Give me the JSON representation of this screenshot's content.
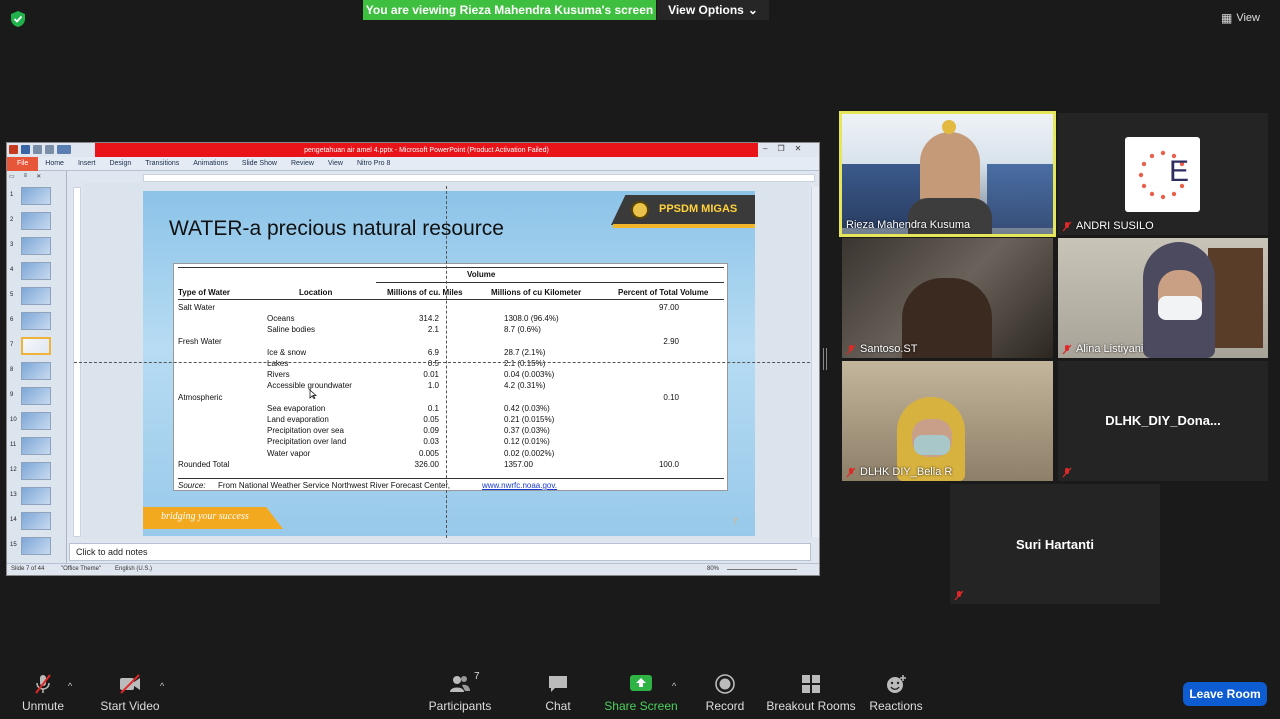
{
  "banner": {
    "text": "You are viewing Rieza Mahendra Kusuma's screen",
    "view_options": "View Options"
  },
  "top_right": {
    "view_label": "View"
  },
  "ppt": {
    "title": "pengetahuan air amel 4.pptx - Microsoft PowerPoint (Product Activation Failed)",
    "tabs": [
      "File",
      "Home",
      "Insert",
      "Design",
      "Transitions",
      "Animations",
      "Slide Show",
      "Review",
      "View",
      "Nitro Pro 8"
    ],
    "thumb_numbers": [
      "1",
      "2",
      "3",
      "4",
      "5",
      "6",
      "7",
      "8",
      "9",
      "10",
      "11",
      "12",
      "13",
      "14",
      "15"
    ],
    "notes_placeholder": "Click to add notes",
    "status": {
      "slide": "Slide 7 of 44",
      "theme": "\"Office Theme\"",
      "language": "English (U.S.)",
      "zoom": "80%"
    },
    "slide": {
      "title": "WATER-a precious natural resource",
      "logo": "PPSDM MIGAS",
      "footer": "bridging your success",
      "page_number": "7",
      "table": {
        "group_header": "Volume",
        "headers": [
          "Type of Water",
          "Location",
          "Millions of cu. Miles",
          "Millions of cu Kilometer",
          "Percent of Total Volume"
        ],
        "rows": [
          {
            "type": "Salt Water",
            "loc": "",
            "miles": "",
            "km": "",
            "pct": "97.00"
          },
          {
            "type": "",
            "loc": "Oceans",
            "miles": "314.2",
            "km": "1308.0  (96.4%)",
            "pct": ""
          },
          {
            "type": "",
            "loc": "Saline bodies",
            "miles": "2.1",
            "km": "8.7  (0.6%)",
            "pct": ""
          },
          {
            "type": "Fresh Water",
            "loc": "",
            "miles": "",
            "km": "",
            "pct": "2.90"
          },
          {
            "type": "",
            "loc": "Ice & snow",
            "miles": "6.9",
            "km": "28.7  (2.1%)",
            "pct": ""
          },
          {
            "type": "",
            "loc": "Lakes",
            "miles": "0.5",
            "km": "2.1  (0.15%)",
            "pct": ""
          },
          {
            "type": "",
            "loc": "Rivers",
            "miles": "0.01",
            "km": "0.04 (0.003%)",
            "pct": ""
          },
          {
            "type": "",
            "loc": "Accessible groundwater",
            "miles": "1.0",
            "km": "4.2  (0.31%)",
            "pct": ""
          },
          {
            "type": "Atmospheric",
            "loc": "",
            "miles": "",
            "km": "",
            "pct": "0.10"
          },
          {
            "type": "",
            "loc": "Sea evaporation",
            "miles": "0.1",
            "km": "0.42 (0.03%)",
            "pct": ""
          },
          {
            "type": "",
            "loc": "Land evaporation",
            "miles": "0.05",
            "km": "0.21 (0.015%)",
            "pct": ""
          },
          {
            "type": "",
            "loc": "Precipitation over sea",
            "miles": "0.09",
            "km": "0.37 (0.03%)",
            "pct": ""
          },
          {
            "type": "",
            "loc": "Precipitation over land",
            "miles": "0.03",
            "km": "0.12 (0.01%)",
            "pct": ""
          },
          {
            "type": "",
            "loc": "Water vapor",
            "miles": "0.005",
            "km": "0.02 (0.002%)",
            "pct": ""
          },
          {
            "type": "Rounded Total",
            "loc": "",
            "miles": "326.00",
            "km": "1357.00",
            "pct": "100.0"
          }
        ],
        "source_label": "Source:",
        "source_text": "From National Weather Service Northwest River Forecast Center,",
        "source_link": "www.nwrfc.noaa.gov."
      }
    }
  },
  "participants": [
    {
      "name": "Rieza Mahendra Kusuma",
      "muted": false
    },
    {
      "name": "ANDRI SUSILO",
      "muted": true,
      "avatar_letter": "E"
    },
    {
      "name": "Santoso.ST",
      "muted": true
    },
    {
      "name": "Alina Listiyani",
      "muted": true
    },
    {
      "name": "DLHK DIY_Bella R",
      "muted": true
    },
    {
      "name": "DLHK_DIY_Dona...",
      "muted": true
    },
    {
      "name": "Suri Hartanti",
      "muted": true
    }
  ],
  "toolbar": {
    "unmute": "Unmute",
    "start_video": "Start Video",
    "participants": "Participants",
    "participants_count": "7",
    "chat": "Chat",
    "share_screen": "Share Screen",
    "record": "Record",
    "breakout": "Breakout Rooms",
    "reactions": "Reactions",
    "leave": "Leave Room"
  },
  "colors": {
    "banner_green": "#3fbf3f",
    "leave_blue": "#0e5cd1",
    "active_speaker": "#e6e65a",
    "ppt_red": "#e8141a"
  }
}
